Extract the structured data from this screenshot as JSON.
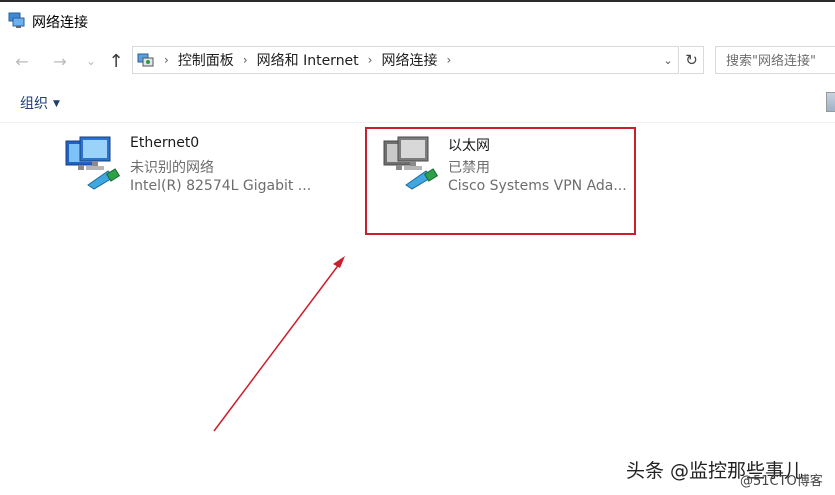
{
  "window": {
    "title": "网络连接"
  },
  "navigation": {
    "back_glyph": "←",
    "forward_glyph": "→",
    "recent_glyph": "⌄",
    "up_glyph": "↑",
    "breadcrumb": [
      "控制面板",
      "网络和 Internet",
      "网络连接"
    ],
    "separator": "›",
    "dropdown_glyph": "⌄",
    "refresh_glyph": "↻"
  },
  "search": {
    "placeholder": "搜索\"网络连接\""
  },
  "toolbar": {
    "organize_label": "组织",
    "organize_caret": "▼"
  },
  "connections": [
    {
      "name": "Ethernet0",
      "status": "未识别的网络",
      "device": "Intel(R) 82574L Gigabit ...",
      "enabled": true
    },
    {
      "name": "以太网",
      "status": "已禁用",
      "device": "Cisco Systems VPN Ada...",
      "enabled": false
    }
  ],
  "annotation": {
    "highlight_color": "#c8202a",
    "arrow_color": "#c8202a"
  },
  "watermark": {
    "text": "头条 @监控那些事儿",
    "subtext": "@51CTO博客"
  }
}
